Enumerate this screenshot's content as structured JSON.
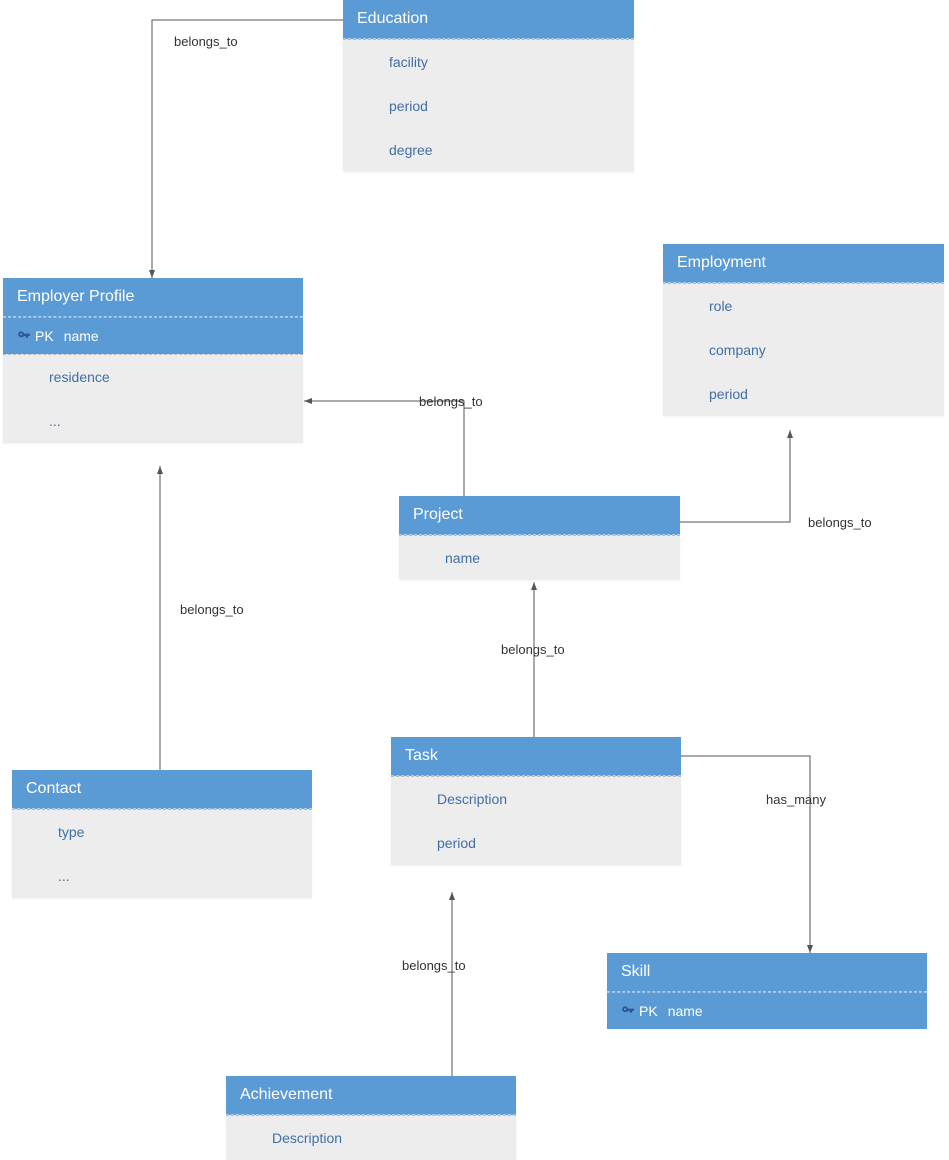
{
  "entities": {
    "education": {
      "title": "Education",
      "attrs": [
        "facility",
        "period",
        "degree"
      ]
    },
    "employer_profile": {
      "title": "Employer Profile",
      "pk": "name",
      "attrs": [
        "residence",
        "..."
      ]
    },
    "employment": {
      "title": "Employment",
      "attrs": [
        "role",
        "company",
        "period"
      ]
    },
    "project": {
      "title": "Project",
      "attrs": [
        "name"
      ]
    },
    "contact": {
      "title": "Contact",
      "attrs": [
        "type",
        "..."
      ]
    },
    "task": {
      "title": "Task",
      "attrs": [
        "Description",
        "period"
      ]
    },
    "achievement": {
      "title": "Achievement",
      "attrs": [
        "Description"
      ]
    },
    "skill": {
      "title": "Skill",
      "pk": "name"
    }
  },
  "labels": {
    "belongs_to": "belongs_to",
    "has_many": "has_many",
    "pk": "PK"
  }
}
